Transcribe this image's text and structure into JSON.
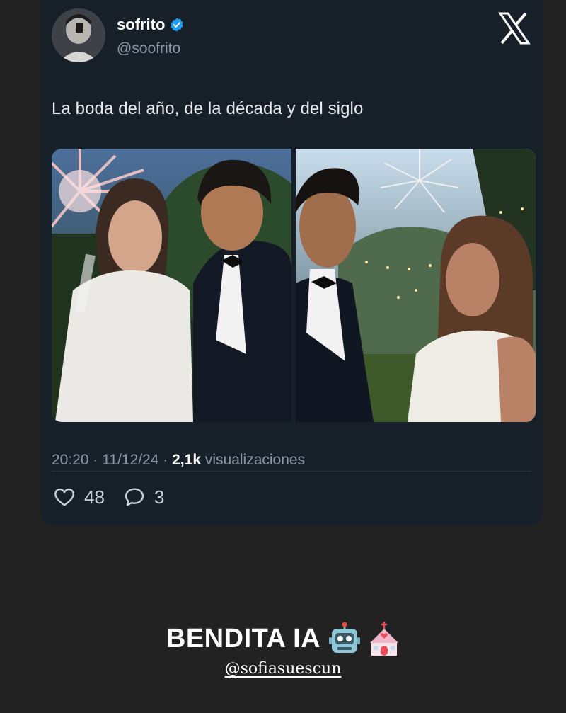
{
  "tweet": {
    "display_name": "sofrito",
    "handle": "@soofrito",
    "verified": true,
    "text": "La boda del año, de la década y del siglo",
    "time": "20:20",
    "date": "11/12/24",
    "views_count": "2,1k",
    "views_label": "visualizaciones",
    "likes": "48",
    "replies": "3",
    "icons": [
      "verified-badge-icon",
      "x-logo-icon",
      "heart-icon",
      "reply-icon"
    ],
    "colors": {
      "card_bg": "#172029",
      "verified": "#1d9bf0",
      "secondary_text": "#8b98a5"
    }
  },
  "story": {
    "caption": "BENDITA IA",
    "caption_emojis": [
      "robot-emoji",
      "wedding-chapel-emoji"
    ],
    "mention": "@sofiasuescun",
    "background": "#222222"
  }
}
